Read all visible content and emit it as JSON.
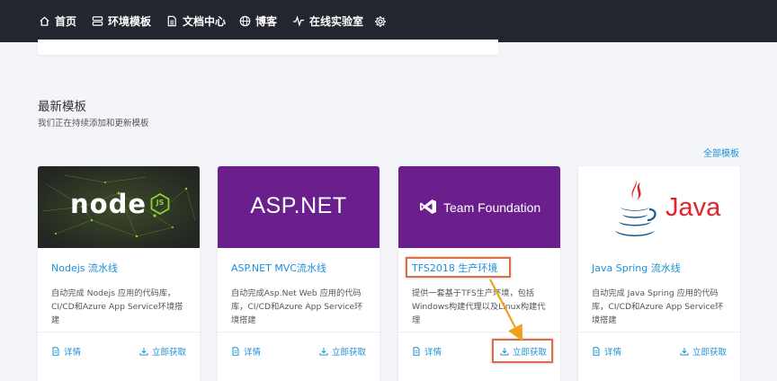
{
  "nav": {
    "items": [
      {
        "label": "首页",
        "icon": "home-icon"
      },
      {
        "label": "环境模板",
        "icon": "server-icon"
      },
      {
        "label": "文档中心",
        "icon": "document-icon"
      },
      {
        "label": "博客",
        "icon": "globe-icon"
      },
      {
        "label": "在线实验室",
        "icon": "pulse-icon"
      }
    ],
    "settings_icon": "gear-icon"
  },
  "section": {
    "title": "最新模板",
    "subtitle": "我们正在持续添加和更新模板",
    "all_link": "全部模板"
  },
  "cards": [
    {
      "banner_text": "node",
      "banner_badge": "JS",
      "title": "Nodejs 流水线",
      "description": "自动完成 Nodejs 应用的代码库，CI/CD和Azure App Service环境搭建",
      "details_label": "详情",
      "get_label": "立即获取"
    },
    {
      "banner_text": "ASP.NET",
      "title": "ASP.NET MVC流水线",
      "description": "自动完成Asp.Net Web 应用的代码库，CI/CD和Azure App Service环境搭建",
      "details_label": "详情",
      "get_label": "立即获取"
    },
    {
      "banner_text": "Team Foundation",
      "title": "TFS2018 生产环境",
      "description": "提供一套基于TFS生产环境，包括Windows构建代理以及Linux构建代理",
      "details_label": "详情",
      "get_label": "立即获取"
    },
    {
      "banner_text": "Java",
      "title": "Java Spring 流水线",
      "description": "自动完成 Java Spring 应用的代码库，CI/CD和Azure App Service环境搭建",
      "details_label": "详情",
      "get_label": "立即获取"
    }
  ],
  "colors": {
    "nav_bg": "#23262e",
    "link_blue": "#1e90d8",
    "purple": "#6a1f8c",
    "highlight": "#d9704a",
    "arrow": "#f0a21b"
  }
}
